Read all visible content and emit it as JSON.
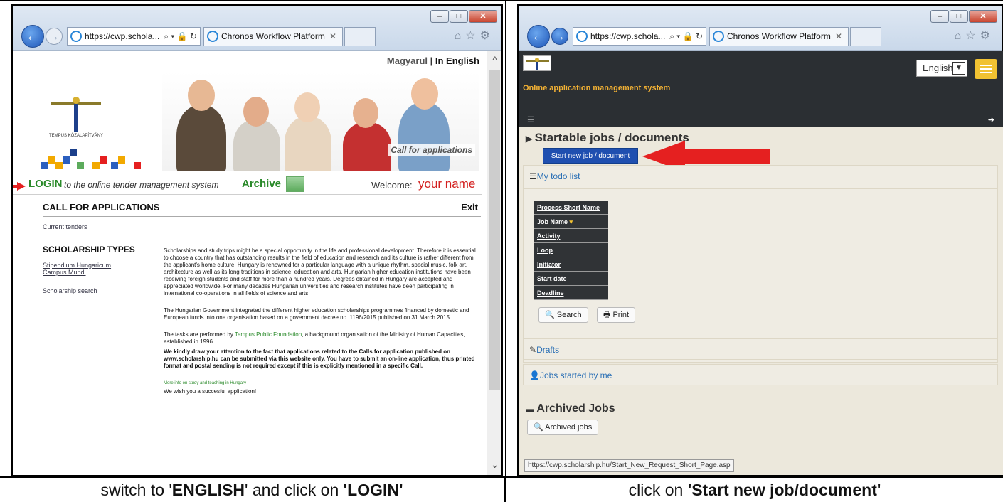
{
  "left": {
    "address": "https://cwp.schola...",
    "tab_title": "Chronos Workflow Platform",
    "lang_hu": "Magyarul",
    "lang_sep": " | ",
    "lang_en": "In English",
    "logo_text": "TEMPUS KÖZALAPÍTVÁNY",
    "banner_caption": "Call for applications",
    "login": "LOGIN",
    "login_desc": "to the online tender management system",
    "archive": "Archive",
    "welcome": "Welcome:",
    "your_name": "your name",
    "call_for_applications": "CALL FOR APPLICATIONS",
    "exit": "Exit",
    "current_tenders": "Current tenders",
    "scholarship_types": "SCHOLARSHIP TYPES",
    "stipendium": "Stipendium Hungaricum",
    "campus_mundi": "Campus Mundi",
    "scholarship_search": "Scholarship search",
    "p1": "Scholarships and study trips might be a special opportunity in the life and professional development. Therefore it is essential to choose a country that has outstanding results in the field of education and research and its culture is rather different from the applicant's home culture. Hungary is renowned for a particular language with a unique rhythm, special music, folk art, architecture as well as its long traditions in science, education and arts. Hungarian higher education institutions have been receiving foreign students and staff for more than a hundred years. Degrees obtained in Hungary are accepted and appreciated worldwide. For many decades Hungarian universities and research institutes have been participating in international co-operations in all fields of science and arts.",
    "p2": "The Hungarian Government integrated the different higher education scholarships programmes financed by domestic and European funds into one organisation based on a government decree no. 1196/2015 published on 31 March 2015.",
    "p3_a": "The tasks are performed by ",
    "p3_link": "Tempus Public Foundation",
    "p3_b": ", a background organisation of the Ministry of Human Capacities, established in 1996.",
    "p4": "We kindly draw your attention to the fact that applications related to the Calls for application published on www.scholarship.hu can be submitted via this website only. You have to submit an on-line application, thus printed format and postal sending is not required except if this is explicitly mentioned in a specific Call.",
    "more_info": "More info on study and teaching in Hungary",
    "wish": "We wish you a succesful application!"
  },
  "right": {
    "address": "https://cwp.schola...",
    "tab_title": "Chronos Workflow Platform",
    "lang_select": "English",
    "system_title": "Online application management system",
    "startable": "Startable jobs / documents",
    "start_btn": "Start new job / document",
    "todo": "My todo list",
    "columns": [
      "Process Short Name",
      "Job Name",
      "Activity",
      "Loop",
      "Initiator",
      "Start date",
      "Deadline"
    ],
    "search_btn": "Search",
    "print_btn": "Print",
    "drafts": "Drafts",
    "jobs_started": "Jobs started by me",
    "archived_heading": "Archived Jobs",
    "archived_btn": "Archived jobs",
    "status_url": "https://cwp.scholarship.hu/Start_New_Request_Short_Page.asp"
  },
  "captions": {
    "left_a": "switch  to '",
    "left_b": "ENGLISH",
    "left_c": "'  and  click on ",
    "left_d": "'LOGIN'",
    "right_a": "click on ",
    "right_b": "'Start new job/document'"
  },
  "colors": {
    "accent_red": "#e52020",
    "login_green": "#2a8a2a",
    "cwp_blue": "#1f4fb0",
    "header_dark": "#2b2f33",
    "menu_yellow": "#f1c232"
  }
}
